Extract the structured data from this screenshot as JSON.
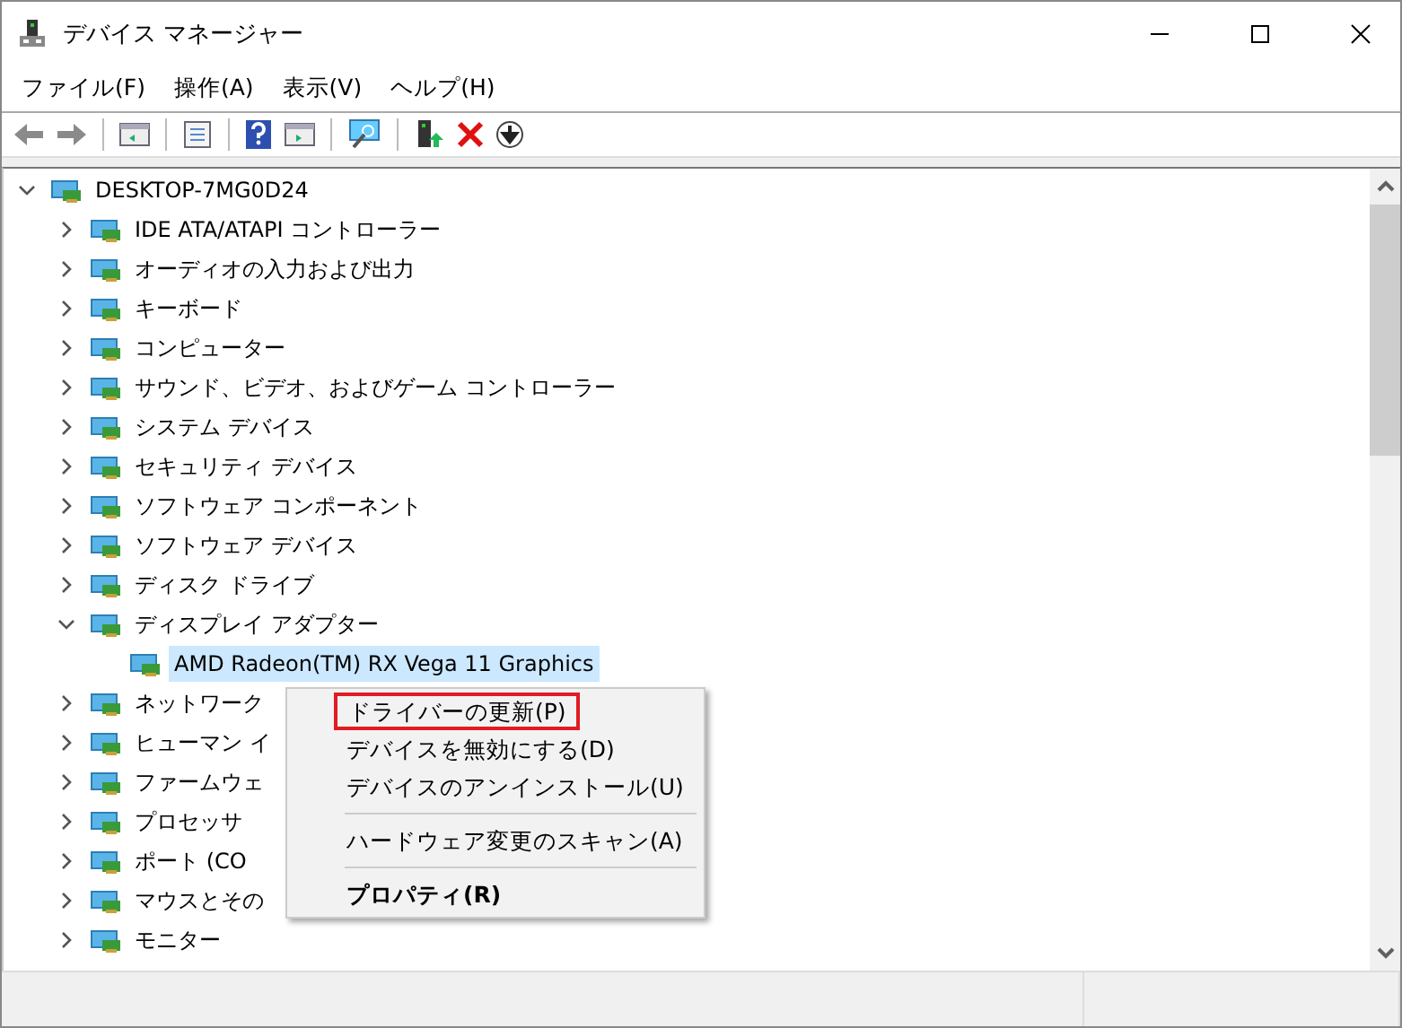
{
  "window": {
    "title": "デバイス マネージャー"
  },
  "menu_bar": [
    "ファイル(F)",
    "操作(A)",
    "表示(V)",
    "ヘルプ(H)"
  ],
  "tree": {
    "label": "DESKTOP-7MG0D24",
    "expanded": true,
    "selected": false,
    "children": [
      {
        "label": "IDE ATA/ATAPI コントローラー",
        "expanded": false,
        "selected": false
      },
      {
        "label": "オーディオの入力および出力",
        "expanded": false,
        "selected": false
      },
      {
        "label": "キーボード",
        "expanded": false,
        "selected": false
      },
      {
        "label": "コンピューター",
        "expanded": false,
        "selected": false
      },
      {
        "label": "サウンド、ビデオ、およびゲーム コントローラー",
        "expanded": false,
        "selected": false
      },
      {
        "label": "システム デバイス",
        "expanded": false,
        "selected": false
      },
      {
        "label": "セキュリティ デバイス",
        "expanded": false,
        "selected": false
      },
      {
        "label": "ソフトウェア コンポーネント",
        "expanded": false,
        "selected": false
      },
      {
        "label": "ソフトウェア デバイス",
        "expanded": false,
        "selected": false
      },
      {
        "label": "ディスク ドライブ",
        "expanded": false,
        "selected": false
      },
      {
        "label": "ディスプレイ アダプター",
        "expanded": true,
        "selected": false,
        "children": [
          {
            "label": "AMD Radeon(TM) RX Vega 11 Graphics",
            "selected": true
          }
        ]
      },
      {
        "label": "ネットワーク",
        "expanded": false,
        "selected": false
      },
      {
        "label": "ヒューマン イ",
        "expanded": false,
        "selected": false
      },
      {
        "label": "ファームウェ",
        "expanded": false,
        "selected": false
      },
      {
        "label": "プロセッサ",
        "expanded": false,
        "selected": false
      },
      {
        "label": "ポート (CO",
        "expanded": false,
        "selected": false
      },
      {
        "label": "マウスとその",
        "expanded": false,
        "selected": false
      },
      {
        "label": "モニター",
        "expanded": false,
        "selected": false
      }
    ]
  },
  "context_menu": [
    {
      "kind": "item",
      "label": "ドライバーの更新(P)",
      "outlined": true,
      "default": false
    },
    {
      "kind": "item",
      "label": "デバイスを無効にする(D)",
      "outlined": false,
      "default": false
    },
    {
      "kind": "item",
      "label": "デバイスのアンインストール(U)",
      "outlined": false,
      "default": false
    },
    {
      "kind": "separator"
    },
    {
      "kind": "item",
      "label": "ハードウェア変更のスキャン(A)",
      "outlined": false,
      "default": false
    },
    {
      "kind": "separator"
    },
    {
      "kind": "item",
      "label": "プロパティ(R)",
      "outlined": false,
      "default": true
    }
  ]
}
